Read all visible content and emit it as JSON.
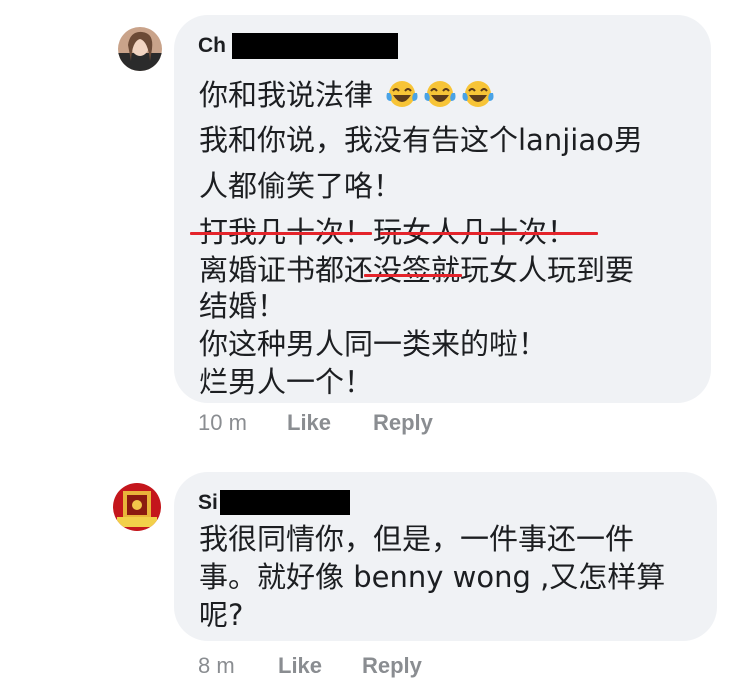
{
  "comments": [
    {
      "author_visible": "Ch",
      "lines": [
        "你和我说法律",
        "我和你说，我没有告这个lanjiao男",
        "人都偷笑了咯！",
        "打我几十次！玩女人几十次！",
        "离婚证书都还没签就玩女人玩到要",
        "结婚！",
        "你这种男人同一类来的啦！",
        "烂男人一个！"
      ],
      "emoji": [
        "face-with-tears-of-joy-icon",
        "face-with-tears-of-joy-icon",
        "face-with-tears-of-joy-icon"
      ],
      "time": "10 m",
      "like": "Like",
      "reply": "Reply"
    },
    {
      "author_visible": "Si",
      "lines": [
        "我很同情你，但是，一件事还一件",
        "事。就好像 benny wong ,又怎样算",
        "呢?"
      ],
      "time": "8 m",
      "like": "Like",
      "reply": "Reply"
    }
  ],
  "colors": {
    "bubble": "#f0f2f5",
    "meta_text": "#8a8d91",
    "underline": "#e4242b",
    "redaction": "#000000"
  }
}
